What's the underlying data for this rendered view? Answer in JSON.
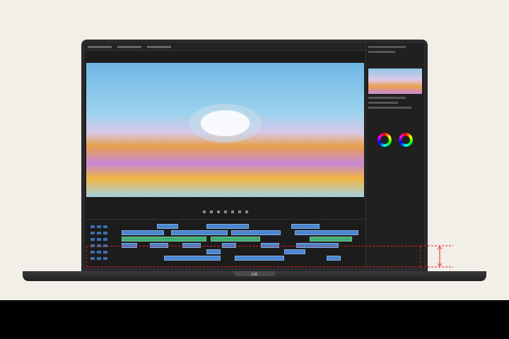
{
  "logo": "LG",
  "timeline": {
    "tracks": [
      {
        "color": "#4a86d0"
      },
      {
        "color": "#4a86d0"
      },
      {
        "color": "#3fae70"
      },
      {
        "color": "#4a86d0"
      },
      {
        "color": "#4a86d0"
      },
      {
        "color": "#4a86d0"
      }
    ]
  }
}
